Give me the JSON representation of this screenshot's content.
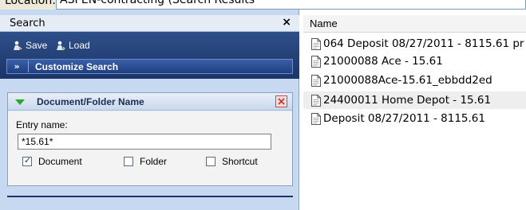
{
  "location": {
    "label": "Location:",
    "value": "ASPEN-contracting (Search Results"
  },
  "search_panel": {
    "title": "Search",
    "close_label": "×",
    "toolbar": {
      "save_label": "Save",
      "load_label": "Load"
    },
    "customize_label": "Customize Search",
    "doc_panel": {
      "title": "Document/Folder Name",
      "entry_label": "Entry name:",
      "entry_value": "*15.61*",
      "checkboxes": [
        {
          "label": "Document",
          "checked": true
        },
        {
          "label": "Folder",
          "checked": false
        },
        {
          "label": "Shortcut",
          "checked": false
        }
      ]
    }
  },
  "results": {
    "column_header": "Name",
    "files": [
      {
        "name": "064 Deposit 08/27/2011 - 8115.61 pr",
        "selected": false
      },
      {
        "name": "21000088 Ace - 15.61",
        "selected": false
      },
      {
        "name": "21000088Ace-15.61_ebbdd2ed",
        "selected": false
      },
      {
        "name": "24400011 Home Depot - 15.61",
        "selected": true
      },
      {
        "name": "Deposit 08/27/2011 - 8115.61",
        "selected": false
      }
    ]
  },
  "colors": {
    "navy": "#1b3468",
    "panel_bg": "#c6d9f0",
    "selected_row": "#eeeeee"
  }
}
